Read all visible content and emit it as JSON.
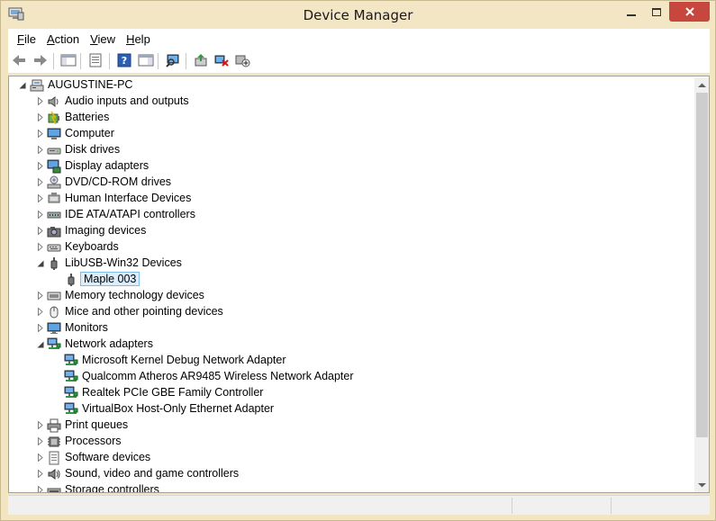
{
  "window": {
    "title": "Device Manager"
  },
  "menu": [
    {
      "pre": "",
      "ul": "F",
      "post": "ile"
    },
    {
      "pre": "",
      "ul": "A",
      "post": "ction"
    },
    {
      "pre": "",
      "ul": "V",
      "post": "iew"
    },
    {
      "pre": "",
      "ul": "H",
      "post": "elp"
    }
  ],
  "toolbar": [
    {
      "name": "back-button",
      "icon": "arrow-left-icon"
    },
    {
      "name": "forward-button",
      "icon": "arrow-right-icon"
    },
    {
      "name": "show-hide-console-tree-button",
      "icon": "console-tree-icon"
    },
    {
      "name": "properties-button",
      "icon": "properties-icon"
    },
    {
      "name": "help-button",
      "icon": "help-icon"
    },
    {
      "name": "show-hide-action-pane-button",
      "icon": "action-pane-icon"
    },
    {
      "name": "scan-hardware-changes-button",
      "icon": "scan-monitor-icon"
    },
    {
      "name": "update-driver-button",
      "icon": "update-driver-icon"
    },
    {
      "name": "uninstall-device-button",
      "icon": "uninstall-icon"
    },
    {
      "name": "add-legacy-hardware-button",
      "icon": "add-hardware-icon"
    }
  ],
  "tree": {
    "root": "AUGUSTINE-PC",
    "items": [
      {
        "label": "Audio inputs and outputs",
        "icon": "speaker-icon",
        "level": 1,
        "state": "collapsed"
      },
      {
        "label": "Batteries",
        "icon": "battery-icon",
        "level": 1,
        "state": "collapsed"
      },
      {
        "label": "Computer",
        "icon": "computer-icon",
        "level": 1,
        "state": "collapsed"
      },
      {
        "label": "Disk drives",
        "icon": "disk-drive-icon",
        "level": 1,
        "state": "collapsed"
      },
      {
        "label": "Display adapters",
        "icon": "display-adapter-icon",
        "level": 1,
        "state": "collapsed"
      },
      {
        "label": "DVD/CD-ROM drives",
        "icon": "dvd-drive-icon",
        "level": 1,
        "state": "collapsed"
      },
      {
        "label": "Human Interface Devices",
        "icon": "hid-icon",
        "level": 1,
        "state": "collapsed"
      },
      {
        "label": "IDE ATA/ATAPI controllers",
        "icon": "ide-controller-icon",
        "level": 1,
        "state": "collapsed"
      },
      {
        "label": "Imaging devices",
        "icon": "camera-icon",
        "level": 1,
        "state": "collapsed"
      },
      {
        "label": "Keyboards",
        "icon": "keyboard-icon",
        "level": 1,
        "state": "collapsed"
      },
      {
        "label": "LibUSB-Win32 Devices",
        "icon": "usb-plug-icon",
        "level": 1,
        "state": "expanded"
      },
      {
        "label": "Maple 003",
        "icon": "usb-plug-icon",
        "level": 2,
        "state": "leaf",
        "selected": true
      },
      {
        "label": "Memory technology devices",
        "icon": "memory-device-icon",
        "level": 1,
        "state": "collapsed"
      },
      {
        "label": "Mice and other pointing devices",
        "icon": "mouse-icon",
        "level": 1,
        "state": "collapsed"
      },
      {
        "label": "Monitors",
        "icon": "monitor-icon",
        "level": 1,
        "state": "collapsed"
      },
      {
        "label": "Network adapters",
        "icon": "network-adapter-icon",
        "level": 1,
        "state": "expanded"
      },
      {
        "label": "Microsoft Kernel Debug Network Adapter",
        "icon": "network-adapter-icon",
        "level": 2,
        "state": "leaf"
      },
      {
        "label": "Qualcomm Atheros AR9485 Wireless Network Adapter",
        "icon": "network-adapter-icon",
        "level": 2,
        "state": "leaf"
      },
      {
        "label": "Realtek PCIe GBE Family Controller",
        "icon": "network-adapter-icon",
        "level": 2,
        "state": "leaf"
      },
      {
        "label": "VirtualBox Host-Only Ethernet Adapter",
        "icon": "network-adapter-icon",
        "level": 2,
        "state": "leaf"
      },
      {
        "label": "Print queues",
        "icon": "printer-icon",
        "level": 1,
        "state": "collapsed"
      },
      {
        "label": "Processors",
        "icon": "processor-icon",
        "level": 1,
        "state": "collapsed"
      },
      {
        "label": "Software devices",
        "icon": "software-device-icon",
        "level": 1,
        "state": "collapsed"
      },
      {
        "label": "Sound, video and game controllers",
        "icon": "sound-icon",
        "level": 1,
        "state": "collapsed"
      },
      {
        "label": "Storage controllers",
        "icon": "storage-controller-icon",
        "level": 1,
        "state": "collapsed"
      }
    ]
  },
  "colors": {
    "frame": "#f2e5c2",
    "close": "#c7463d",
    "selection_bg": "#dceefc",
    "selection_border": "#7fbcea"
  }
}
